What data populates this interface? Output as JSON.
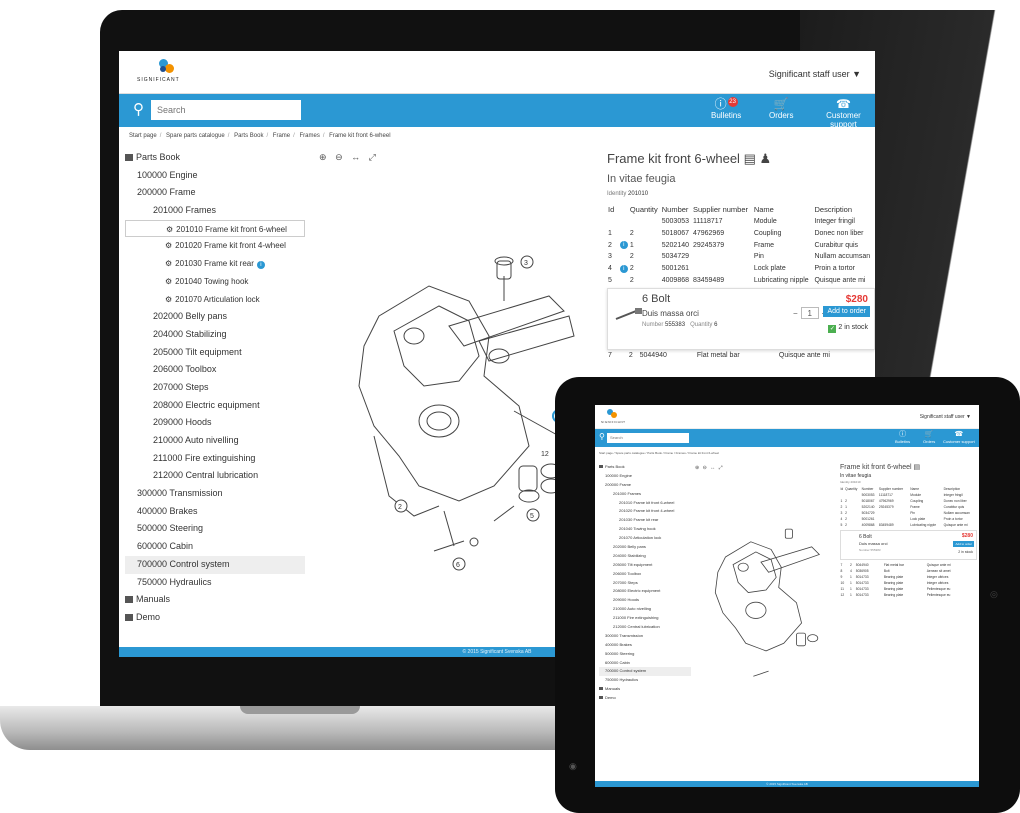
{
  "app": {
    "logo_text": "SIGNIFICANT",
    "user_menu": "Significant staff user ▼",
    "search_placeholder": "Search",
    "nav": [
      {
        "label": "Bulletins",
        "icon": "info-icon",
        "badge": "23"
      },
      {
        "label": "Orders",
        "icon": "cart-icon"
      },
      {
        "label": "Customer support",
        "icon": "phone-icon"
      }
    ],
    "breadcrumbs": [
      "Start page",
      "Spare parts catalogue",
      "Parts Book",
      "Frame",
      "Frames",
      "Frame kit front 6-wheel"
    ],
    "footer": "© 2015 Significant Svenska AB",
    "accent_color": "#2b98d3"
  },
  "tree": {
    "root": "Parts Book",
    "items": [
      {
        "label": "100000 Engine",
        "level": 1
      },
      {
        "label": "200000 Frame",
        "level": 1
      },
      {
        "label": "201000 Frames",
        "level": 2
      },
      {
        "label": "201010 Frame kit front 6-wheel",
        "level": 3,
        "icon": "cog-icon"
      },
      {
        "label": "201020 Frame kit front 4-wheel",
        "level": 3,
        "icon": "cog-icon"
      },
      {
        "label": "201030 Frame kit rear",
        "level": 3,
        "icon": "cog-icon",
        "info": "i"
      },
      {
        "label": "201040 Towing hook",
        "level": 3,
        "icon": "cog-icon"
      },
      {
        "label": "201070 Articulation lock",
        "level": 3,
        "icon": "cog-icon"
      },
      {
        "label": "202000 Belly pans",
        "level": 2
      },
      {
        "label": "204000 Stabilizing",
        "level": 2
      },
      {
        "label": "205000 Tilt equipment",
        "level": 2
      },
      {
        "label": "206000 Toolbox",
        "level": 2
      },
      {
        "label": "207000 Steps",
        "level": 2
      },
      {
        "label": "208000 Electric equipment",
        "level": 2
      },
      {
        "label": "209000 Hoods",
        "level": 2
      },
      {
        "label": "210000 Auto nivelling",
        "level": 2
      },
      {
        "label": "211000 Fire extinguishing",
        "level": 2
      },
      {
        "label": "212000 Central lubrication",
        "level": 2
      },
      {
        "label": "300000 Transmission",
        "level": 1
      },
      {
        "label": "400000 Brakes",
        "level": 1
      },
      {
        "label": "500000 Steering",
        "level": 1
      },
      {
        "label": "600000 Cabin",
        "level": 1
      },
      {
        "label": "700000 Control system",
        "level": 1,
        "selected": true
      },
      {
        "label": "750000 Hydraulics",
        "level": 1
      }
    ],
    "extra": [
      "Manuals",
      "Demo"
    ]
  },
  "detail": {
    "title": "Frame kit front 6-wheel",
    "subtitle": "In vitae feugia",
    "identity_label": "Identity",
    "identity_value": "201010",
    "columns": [
      "Id",
      "Quantity",
      "Number",
      "Supplier number",
      "Name",
      "Description"
    ],
    "rows": [
      {
        "id": "",
        "info": "",
        "qty": "",
        "number": "5003053",
        "supplier": "11118717",
        "name": "Module",
        "desc": "Integer fringil"
      },
      {
        "id": "1",
        "info": "",
        "qty": "2",
        "number": "5018067",
        "supplier": "47962969",
        "name": "Coupling",
        "desc": "Donec non liber"
      },
      {
        "id": "2",
        "info": "i",
        "qty": "1",
        "number": "5202140",
        "supplier": "29245379",
        "name": "Frame",
        "desc": "Curabitur quis"
      },
      {
        "id": "3",
        "info": "",
        "qty": "2",
        "number": "5034729",
        "supplier": "",
        "name": "Pin",
        "desc": "Nullam accumsan"
      },
      {
        "id": "4",
        "info": "i",
        "qty": "2",
        "number": "5001261",
        "supplier": "",
        "name": "Lock plate",
        "desc": "Proin a tortor"
      },
      {
        "id": "5",
        "info": "",
        "qty": "2",
        "number": "4009868",
        "supplier": "83459489",
        "name": "Lubricating nipple",
        "desc": "Quisque ante mi"
      }
    ],
    "selected_part": {
      "title": "6 Bolt",
      "description": "Duis massa orci",
      "number_label": "Number",
      "number": "555383",
      "quantity_label": "Quantity",
      "quantity": "6",
      "price": "$280",
      "qty_value": "1",
      "add_label": "Add to order",
      "stock": "2 in stock"
    },
    "after_rows": [
      {
        "id": "7",
        "qty": "2",
        "number": "5044940",
        "supplier": "",
        "name": "Flat metal bar",
        "desc": "Quisque ante mi"
      }
    ]
  },
  "tablet_rows_extra": [
    {
      "id": "7",
      "qty": "2",
      "number": "5044940",
      "name": "Flat metal bar",
      "desc": "Quisque ante mi"
    },
    {
      "id": "8",
      "qty": "4",
      "number": "5036905",
      "name": "Bolt",
      "desc": "Aenean sit amet"
    },
    {
      "id": "9",
      "qty": "1",
      "number": "5014733",
      "name": "Bearing plate",
      "desc": "Integer ultrices"
    },
    {
      "id": "10",
      "qty": "1",
      "number": "5014733",
      "name": "Bearing plate",
      "desc": "Integer ultrices"
    },
    {
      "id": "11",
      "qty": "1",
      "number": "5014733",
      "name": "Bearing plate",
      "desc": "Pellentesque eu"
    },
    {
      "id": "12",
      "qty": "1",
      "number": "5014733",
      "name": "Bearing plate",
      "desc": "Pellentesque eu"
    }
  ],
  "drawing_labels": [
    "3",
    "2",
    "12",
    "5",
    "6"
  ]
}
